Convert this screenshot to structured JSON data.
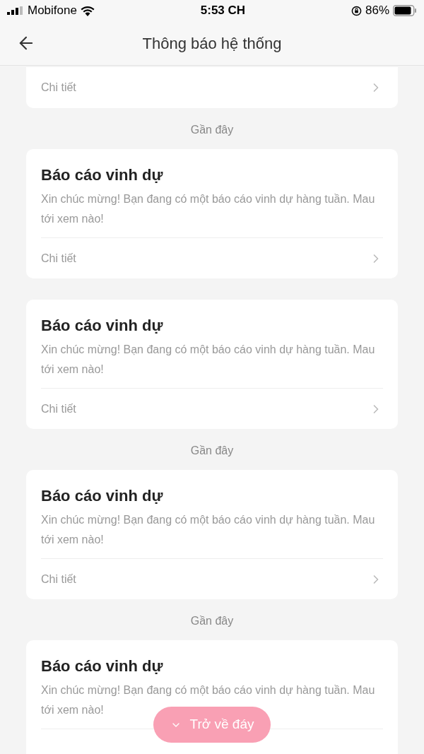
{
  "status_bar": {
    "carrier": "Mobifone",
    "time": "5:53 CH",
    "battery": "86%"
  },
  "header": {
    "title": "Thông báo hệ thống"
  },
  "feed": [
    {
      "kind": "card",
      "link": "Chi tiết"
    },
    {
      "kind": "label",
      "text": "Gần đây"
    },
    {
      "kind": "card",
      "title": "Báo cáo vinh dự",
      "body": "Xin chúc mừng! Bạn đang có một báo cáo vinh dự hàng tuần. Mau tới xem nào!",
      "link": "Chi tiết"
    },
    {
      "kind": "card",
      "title": "Báo cáo vinh dự",
      "body": "Xin chúc mừng! Bạn đang có một báo cáo vinh dự hàng tuần. Mau tới xem nào!",
      "link": "Chi tiết"
    },
    {
      "kind": "label",
      "text": "Gần đây"
    },
    {
      "kind": "card",
      "title": "Báo cáo vinh dự",
      "body": "Xin chúc mừng! Bạn đang có một báo cáo vinh dự hàng tuần. Mau tới xem nào!",
      "link": "Chi tiết"
    },
    {
      "kind": "label",
      "text": "Gần đây"
    },
    {
      "kind": "card",
      "title": "Báo cáo vinh dự",
      "body": "Xin chúc mừng! Bạn đang có một báo cáo vinh dự hàng tuần. Mau tới xem nào!"
    }
  ],
  "float_button": {
    "label": "Trở về đáy"
  }
}
